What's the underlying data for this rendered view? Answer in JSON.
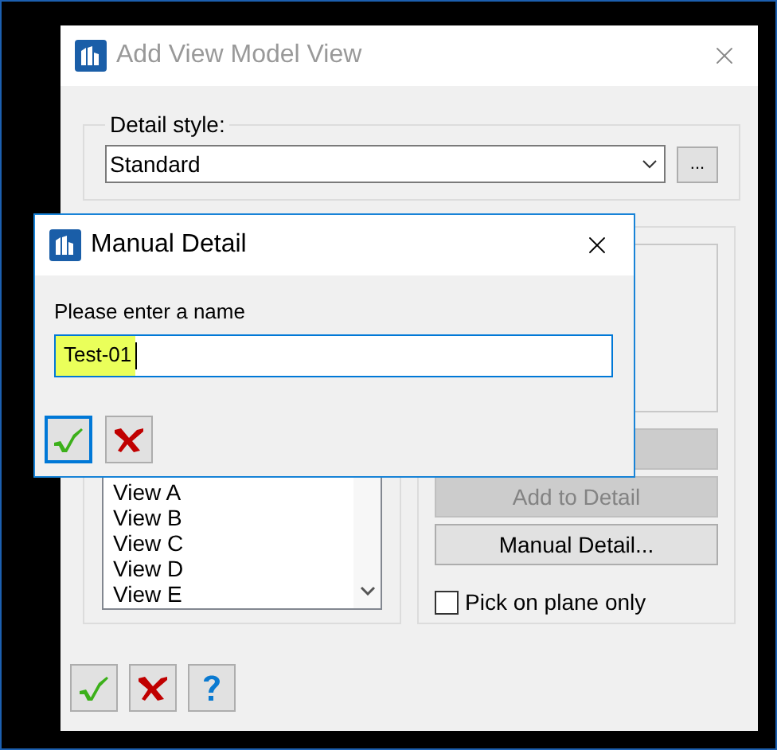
{
  "main_window": {
    "title": "Add View Model View",
    "active": false,
    "detail_style": {
      "label": "Detail style:",
      "value": "Standard",
      "browse_button": "..."
    },
    "views": [
      {
        "label": "View A"
      },
      {
        "label": "View B"
      },
      {
        "label": "View C"
      },
      {
        "label": "View D"
      },
      {
        "label": "View E"
      }
    ],
    "actions": [
      {
        "label": "Add to Detail",
        "disabled": true
      },
      {
        "label": "Manual Detail...",
        "disabled": false
      }
    ],
    "pick_on_plane_only": {
      "label": "Pick on plane only",
      "checked": false
    },
    "buttons": [
      {
        "kind": "ok",
        "selected": false
      },
      {
        "kind": "cancel",
        "selected": false
      },
      {
        "kind": "help",
        "selected": false
      }
    ]
  },
  "manual_detail_dialog": {
    "title": "Manual Detail",
    "active": true,
    "prompt": "Please enter a name",
    "value": "Test-01",
    "buttons": [
      {
        "kind": "ok",
        "selected": true
      },
      {
        "kind": "cancel",
        "selected": false
      }
    ]
  }
}
